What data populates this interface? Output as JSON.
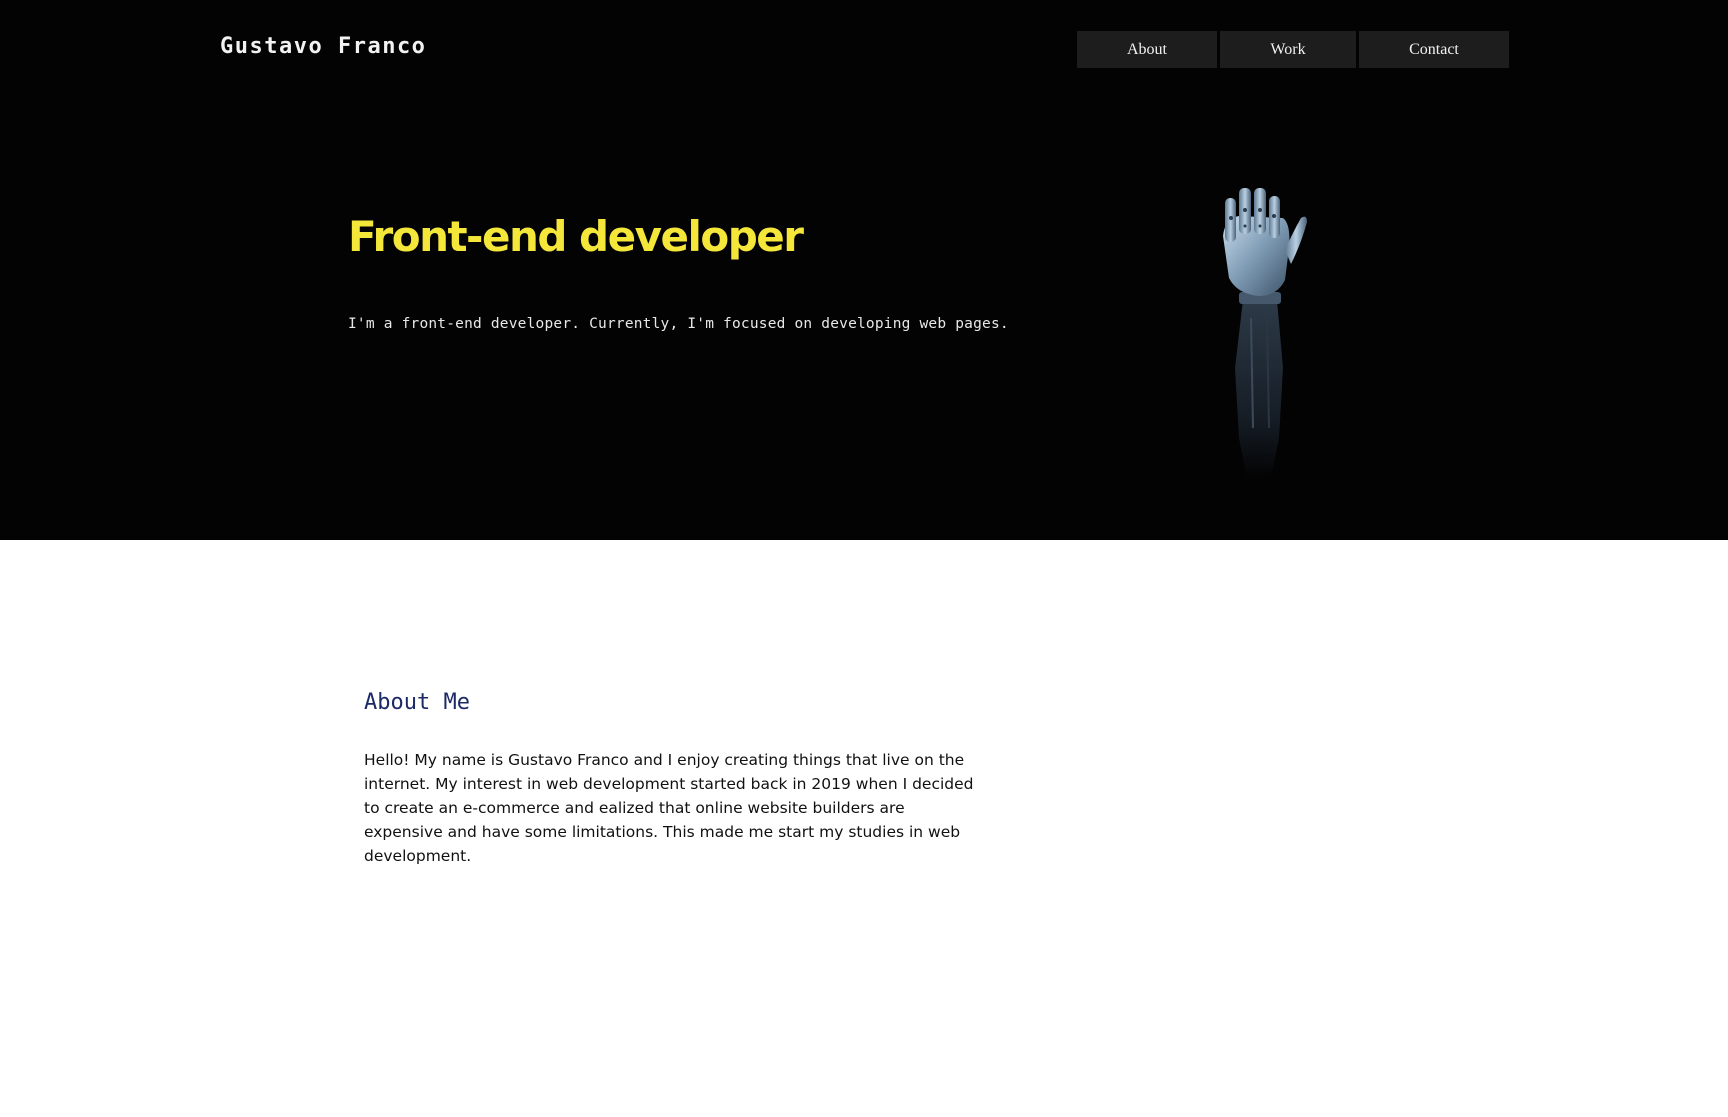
{
  "header": {
    "logo": "Gustavo Franco",
    "nav": [
      {
        "label": "About"
      },
      {
        "label": "Work"
      },
      {
        "label": "Contact"
      }
    ]
  },
  "hero": {
    "title": "Front-end developer",
    "subtitle": "I'm a front-end developer. Currently, I'm focused on developing web pages.",
    "image_icon": "robot-hand-icon"
  },
  "about": {
    "title": "About Me",
    "text": "Hello! My name is Gustavo Franco and I enjoy creating things that live on the internet. My interest in web development started back in 2019 when I decided to create an e-commerce and ealized that online website builders are expensive and have some limitations. This made me start my studies in web development."
  },
  "colors": {
    "hero_bg": "#030303",
    "accent_yellow": "#f5e63a",
    "nav_bg": "#1d1d1d",
    "about_title": "#1b2a66"
  }
}
